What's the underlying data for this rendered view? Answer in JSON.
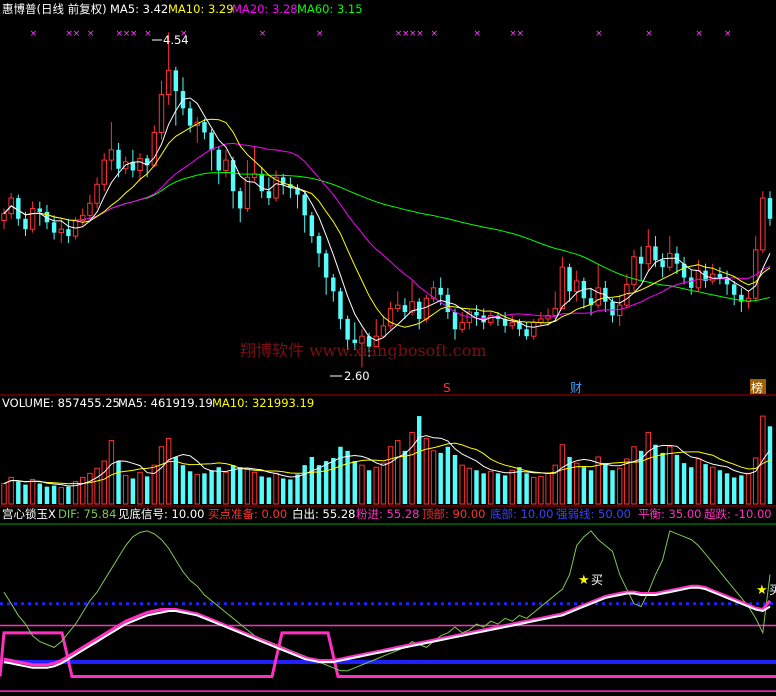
{
  "price_panel": {
    "stock_name": "惠博普(日线 前复权)",
    "ma5_label": "MA5: 3.42",
    "ma10_label": "MA10: 3.29",
    "ma20_label": "MA20: 3.28",
    "ma60_label": "MA60: 3.15",
    "high_label": "4.54",
    "low_label": "2.60",
    "watermark": "翔博软件 www.xiangbosoft.com",
    "markers": [
      "S",
      "财",
      "榜"
    ]
  },
  "volume_panel": {
    "volume_label": "VOLUME: 857455.25",
    "ma5_label": "MA5: 461919.19",
    "ma10_label": "MA10: 321993.19"
  },
  "indicator_panel": {
    "name": "宫心锁玉X",
    "dif": "DIF: 75.84",
    "jiandi": "见底信号: 10.00",
    "maidian": "买点准备: 0.00",
    "baichu": "白出: 55.28",
    "fenjin": "粉进: 55.28",
    "dingbu": "顶部: 90.00",
    "dibu": "底部: 10.00",
    "qiangruo": "强弱线: 50.00",
    "pingheng": "平衡: 35.00",
    "chaodie": "超跌: -10.00",
    "buy_label": "买"
  },
  "colors": {
    "up": "#ff3232",
    "down": "#54fcfc",
    "ma5": "#ffffff",
    "ma10": "#ffff00",
    "ma20": "#ff00ff",
    "ma60": "#00ff00",
    "dif": "#7ec850",
    "pink": "#ff30c0",
    "blue": "#2020ff",
    "grid": "#b00000"
  },
  "chart_data": {
    "type": "candlestick",
    "candles": [
      [
        3.45,
        3.49,
        3.52,
        3.4
      ],
      [
        3.49,
        3.58,
        3.61,
        3.46
      ],
      [
        3.58,
        3.46,
        3.6,
        3.42
      ],
      [
        3.46,
        3.4,
        3.5,
        3.36
      ],
      [
        3.4,
        3.52,
        3.56,
        3.38
      ],
      [
        3.52,
        3.5,
        3.56,
        3.42
      ],
      [
        3.5,
        3.44,
        3.54,
        3.4
      ],
      [
        3.44,
        3.38,
        3.48,
        3.34
      ],
      [
        3.38,
        3.4,
        3.46,
        3.32
      ],
      [
        3.4,
        3.36,
        3.46,
        3.32
      ],
      [
        3.36,
        3.45,
        3.47,
        3.34
      ],
      [
        3.45,
        3.48,
        3.52,
        3.42
      ],
      [
        3.48,
        3.55,
        3.6,
        3.44
      ],
      [
        3.55,
        3.66,
        3.7,
        3.52
      ],
      [
        3.66,
        3.8,
        3.84,
        3.62
      ],
      [
        3.8,
        3.86,
        4.02,
        3.74
      ],
      [
        3.86,
        3.75,
        3.9,
        3.7
      ],
      [
        3.75,
        3.79,
        3.82,
        3.72
      ],
      [
        3.79,
        3.74,
        3.86,
        3.7
      ],
      [
        3.74,
        3.81,
        3.84,
        3.68
      ],
      [
        3.81,
        3.77,
        3.83,
        3.7
      ],
      [
        3.77,
        3.96,
        4.0,
        3.76
      ],
      [
        3.96,
        4.18,
        4.26,
        3.92
      ],
      [
        4.18,
        4.32,
        4.54,
        4.12
      ],
      [
        4.32,
        4.2,
        4.34,
        4.0
      ],
      [
        4.2,
        4.1,
        4.28,
        4.06
      ],
      [
        4.1,
        4.0,
        4.14,
        3.96
      ],
      [
        4.0,
        4.02,
        4.05,
        3.9
      ],
      [
        4.02,
        3.96,
        4.04,
        3.92
      ],
      [
        3.96,
        3.86,
        3.98,
        3.74
      ],
      [
        3.86,
        3.74,
        3.88,
        3.66
      ],
      [
        3.74,
        3.8,
        3.86,
        3.7
      ],
      [
        3.8,
        3.62,
        3.82,
        3.52
      ],
      [
        3.62,
        3.52,
        3.64,
        3.44
      ],
      [
        3.52,
        3.7,
        3.8,
        3.5
      ],
      [
        3.7,
        3.72,
        3.88,
        3.68
      ],
      [
        3.72,
        3.62,
        3.76,
        3.58
      ],
      [
        3.62,
        3.58,
        3.7,
        3.54
      ],
      [
        3.58,
        3.7,
        3.74,
        3.56
      ],
      [
        3.7,
        3.66,
        3.72,
        3.6
      ],
      [
        3.66,
        3.64,
        3.7,
        3.58
      ],
      [
        3.64,
        3.6,
        3.66,
        3.52
      ],
      [
        3.6,
        3.48,
        3.62,
        3.38
      ],
      [
        3.48,
        3.36,
        3.5,
        3.32
      ],
      [
        3.36,
        3.26,
        3.38,
        3.18
      ],
      [
        3.26,
        3.12,
        3.28,
        3.02
      ],
      [
        3.12,
        3.04,
        3.14,
        2.98
      ],
      [
        3.04,
        2.88,
        3.06,
        2.82
      ],
      [
        2.88,
        2.76,
        2.9,
        2.7
      ],
      [
        2.76,
        2.74,
        2.86,
        2.7
      ],
      [
        2.74,
        2.78,
        2.82,
        2.6
      ],
      [
        2.78,
        2.72,
        2.8,
        2.66
      ],
      [
        2.72,
        2.78,
        2.88,
        2.72
      ],
      [
        2.78,
        2.84,
        2.9,
        2.78
      ],
      [
        2.84,
        2.94,
        2.98,
        2.82
      ],
      [
        2.94,
        2.96,
        3.04,
        2.92
      ],
      [
        2.96,
        2.92,
        3.0,
        2.88
      ],
      [
        2.92,
        2.98,
        3.1,
        2.9
      ],
      [
        2.98,
        2.88,
        3.0,
        2.82
      ],
      [
        2.88,
        3.0,
        3.02,
        2.86
      ],
      [
        3.0,
        3.06,
        3.1,
        2.98
      ],
      [
        3.06,
        3.02,
        3.12,
        2.96
      ],
      [
        3.02,
        2.92,
        3.06,
        2.88
      ],
      [
        2.92,
        2.82,
        2.94,
        2.76
      ],
      [
        2.82,
        2.86,
        2.92,
        2.8
      ],
      [
        2.86,
        2.92,
        2.94,
        2.82
      ],
      [
        2.92,
        2.9,
        2.96,
        2.84
      ],
      [
        2.9,
        2.86,
        2.94,
        2.82
      ],
      [
        2.86,
        2.9,
        2.92,
        2.84
      ],
      [
        2.9,
        2.88,
        2.92,
        2.84
      ],
      [
        2.88,
        2.84,
        2.92,
        2.8
      ],
      [
        2.84,
        2.86,
        2.9,
        2.82
      ],
      [
        2.86,
        2.82,
        2.88,
        2.78
      ],
      [
        2.82,
        2.78,
        2.86,
        2.76
      ],
      [
        2.78,
        2.86,
        2.88,
        2.76
      ],
      [
        2.86,
        2.88,
        2.92,
        2.84
      ],
      [
        2.88,
        2.9,
        2.94,
        2.84
      ],
      [
        2.9,
        2.94,
        3.04,
        2.88
      ],
      [
        2.94,
        3.18,
        3.24,
        2.94
      ],
      [
        3.18,
        3.04,
        3.2,
        2.98
      ],
      [
        3.04,
        3.1,
        3.16,
        2.98
      ],
      [
        3.1,
        3.0,
        3.12,
        2.94
      ],
      [
        3.0,
        2.96,
        3.06,
        2.9
      ],
      [
        2.96,
        3.06,
        3.2,
        2.94
      ],
      [
        3.06,
        2.98,
        3.1,
        2.92
      ],
      [
        2.98,
        2.9,
        3.0,
        2.86
      ],
      [
        2.9,
        2.96,
        3.02,
        2.84
      ],
      [
        2.96,
        3.08,
        3.14,
        2.94
      ],
      [
        3.08,
        3.24,
        3.28,
        3.04
      ],
      [
        3.24,
        3.2,
        3.3,
        3.1
      ],
      [
        3.2,
        3.3,
        3.4,
        3.16
      ],
      [
        3.3,
        3.22,
        3.36,
        3.18
      ],
      [
        3.22,
        3.18,
        3.26,
        3.12
      ],
      [
        3.18,
        3.26,
        3.36,
        3.16
      ],
      [
        3.26,
        3.2,
        3.3,
        3.14
      ],
      [
        3.2,
        3.12,
        3.24,
        3.08
      ],
      [
        3.12,
        3.06,
        3.16,
        3.02
      ],
      [
        3.06,
        3.16,
        3.22,
        3.04
      ],
      [
        3.16,
        3.1,
        3.2,
        3.06
      ],
      [
        3.1,
        3.14,
        3.2,
        3.08
      ],
      [
        3.14,
        3.12,
        3.18,
        3.08
      ],
      [
        3.12,
        3.08,
        3.16,
        3.02
      ],
      [
        3.08,
        3.02,
        3.1,
        2.96
      ],
      [
        3.02,
        2.98,
        3.06,
        2.92
      ],
      [
        2.98,
        3.0,
        3.04,
        2.94
      ],
      [
        3.0,
        3.28,
        3.36,
        2.98
      ],
      [
        3.28,
        3.58,
        3.62,
        3.26
      ],
      [
        3.58,
        3.46,
        3.62,
        3.42
      ]
    ],
    "ma5_label": "MA5: 3.42",
    "ma10_label": "MA10: 3.29",
    "ma20_label": "MA20: 3.28",
    "ma60_label": "MA60: 3.15",
    "high": 4.54,
    "low": 2.6,
    "volume": [
      200,
      260,
      220,
      190,
      240,
      200,
      170,
      180,
      160,
      170,
      220,
      260,
      300,
      350,
      420,
      620,
      420,
      280,
      250,
      310,
      270,
      380,
      560,
      640,
      460,
      380,
      320,
      290,
      300,
      330,
      360,
      310,
      380,
      360,
      350,
      310,
      270,
      260,
      300,
      250,
      240,
      290,
      380,
      460,
      380,
      420,
      450,
      560,
      520,
      420,
      380,
      330,
      360,
      400,
      560,
      620,
      520,
      700,
      860,
      640,
      520,
      500,
      560,
      480,
      380,
      350,
      330,
      300,
      320,
      300,
      280,
      330,
      360,
      300,
      260,
      270,
      300,
      380,
      580,
      460,
      400,
      360,
      330,
      460,
      400,
      330,
      350,
      440,
      560,
      520,
      700,
      580,
      500,
      560,
      480,
      400,
      360,
      440,
      390,
      360,
      330,
      300,
      260,
      280,
      300,
      450,
      860,
      760
    ],
    "volume_labels": {
      "volume": "VOLUME: 857455.25",
      "ma5": "MA5: 461919.19",
      "ma10": "MA10: 321993.19"
    },
    "indicator": {
      "dif": [
        58,
        50,
        42,
        36,
        28,
        24,
        22,
        20,
        24,
        30,
        36,
        44,
        52,
        58,
        66,
        74,
        82,
        90,
        96,
        99,
        100,
        98,
        94,
        88,
        80,
        72,
        66,
        62,
        56,
        52,
        48,
        44,
        40,
        36,
        32,
        28,
        26,
        24,
        22,
        20,
        18,
        16,
        14,
        12,
        10,
        8,
        6,
        4,
        4,
        6,
        8,
        10,
        12,
        14,
        16,
        18,
        20,
        24,
        22,
        20,
        24,
        28,
        30,
        34,
        30,
        32,
        36,
        34,
        38,
        36,
        40,
        38,
        42,
        40,
        44,
        48,
        52,
        56,
        60,
        70,
        90,
        96,
        100,
        94,
        90,
        86,
        70,
        60,
        50,
        48,
        58,
        70,
        80,
        100,
        98,
        96,
        94,
        90,
        84,
        78,
        72,
        66,
        60,
        54,
        48,
        40,
        30,
        70
      ],
      "white": [
        10,
        9,
        8,
        7,
        6,
        6,
        6,
        7,
        9,
        12,
        15,
        18,
        21,
        24,
        27,
        30,
        33,
        36,
        38,
        40,
        42,
        43,
        44,
        45,
        45,
        44,
        43,
        42,
        40,
        38,
        36,
        34,
        32,
        30,
        28,
        26,
        24,
        22,
        20,
        18,
        16,
        14,
        12,
        11,
        10,
        10,
        10,
        11,
        12,
        13,
        14,
        15,
        16,
        17,
        18,
        19,
        20,
        21,
        22,
        23,
        24,
        25,
        26,
        27,
        28,
        29,
        30,
        31,
        32,
        33,
        34,
        35,
        36,
        37,
        38,
        39,
        40,
        41,
        42,
        44,
        46,
        48,
        50,
        52,
        54,
        55,
        56,
        57,
        57,
        56,
        56,
        56,
        57,
        58,
        59,
        60,
        61,
        61,
        60,
        58,
        56,
        54,
        52,
        50,
        48,
        46,
        45,
        48
      ],
      "pink_line": [
        12,
        11,
        10,
        9,
        8,
        8,
        8,
        9,
        11,
        14,
        17,
        20,
        23,
        26,
        29,
        32,
        35,
        38,
        40,
        42,
        44,
        45,
        46,
        46,
        46,
        45,
        44,
        43,
        41,
        39,
        37,
        35,
        33,
        31,
        29,
        27,
        25,
        23,
        21,
        19,
        17,
        15,
        13,
        12,
        11,
        11,
        11,
        12,
        13,
        14,
        15,
        16,
        17,
        18,
        19,
        20,
        21,
        22,
        23,
        24,
        25,
        26,
        27,
        28,
        29,
        30,
        31,
        32,
        33,
        34,
        35,
        36,
        37,
        38,
        39,
        40,
        41,
        42,
        43,
        45,
        47,
        49,
        51,
        53,
        55,
        56,
        57,
        58,
        58,
        57,
        57,
        57,
        58,
        59,
        60,
        61,
        62,
        62,
        61,
        59,
        57,
        55,
        53,
        51,
        49,
        47,
        46,
        52
      ],
      "dingbu": "顶部: 90.00",
      "dibu": "底部: 10.00",
      "qiangruo": "强弱线: 50.00",
      "pingheng": "平衡: 35.00",
      "chaodie": "超跌: -10.00"
    }
  }
}
